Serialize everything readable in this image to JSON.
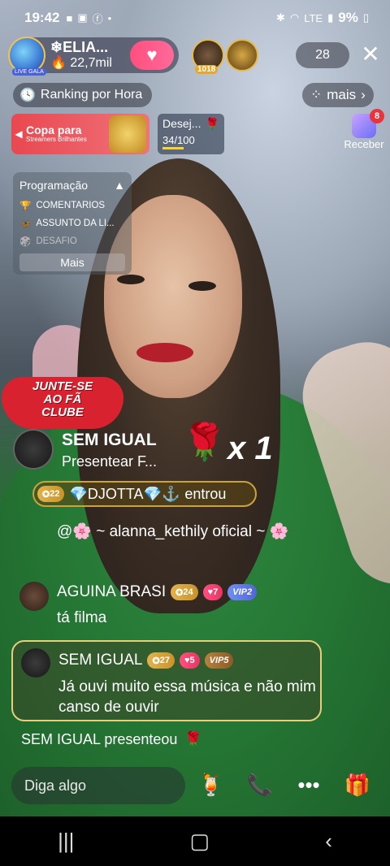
{
  "status_bar": {
    "time": "19:42",
    "battery": "9%",
    "network": "LTE"
  },
  "host": {
    "name": "❄ELIA...",
    "fans": "22,7mil",
    "badge": "LIVE GALA"
  },
  "viewers": {
    "top_badge": "1018",
    "count": "28"
  },
  "ranking": {
    "label": "Ranking por Hora"
  },
  "more": {
    "label": "mais"
  },
  "cup_banner": {
    "title": "Copa para",
    "subtitle": "Streamers Brilhantes"
  },
  "wish": {
    "title": "Desej...",
    "progress": "34/100"
  },
  "receive": {
    "label": "Receber",
    "badge": "8"
  },
  "program": {
    "title": "Programação",
    "items": [
      "COMENTARIOS",
      "ASSUNTO DA LI...",
      "DESAFIO"
    ],
    "more_label": "Mais"
  },
  "fan_club": {
    "label": "JUNTE-SE AO FÃ CLUBE"
  },
  "gift_notice": {
    "name": "SEM IGUAL",
    "desc": "Presentear F...",
    "multiplier": "x 1"
  },
  "entered": {
    "level": "22",
    "name": "💎DJOTTA💎⚓",
    "action": "entrou"
  },
  "mention": {
    "text": "@🌸 ~ alanna_kethily oficial ~ 🌸"
  },
  "chat": [
    {
      "name": "AGUINA BRASI",
      "level": "24",
      "fan": "7",
      "vip": "VIP2",
      "text": "tá filma"
    },
    {
      "name": "SEM IGUAL",
      "level": "27",
      "fan": "5",
      "vip": "VIP5",
      "text": "Já ouvi muito essa música e não mim canso de ouvir"
    }
  ],
  "gift_line": {
    "text": "SEM IGUAL presenteou"
  },
  "input": {
    "placeholder": "Diga algo"
  }
}
